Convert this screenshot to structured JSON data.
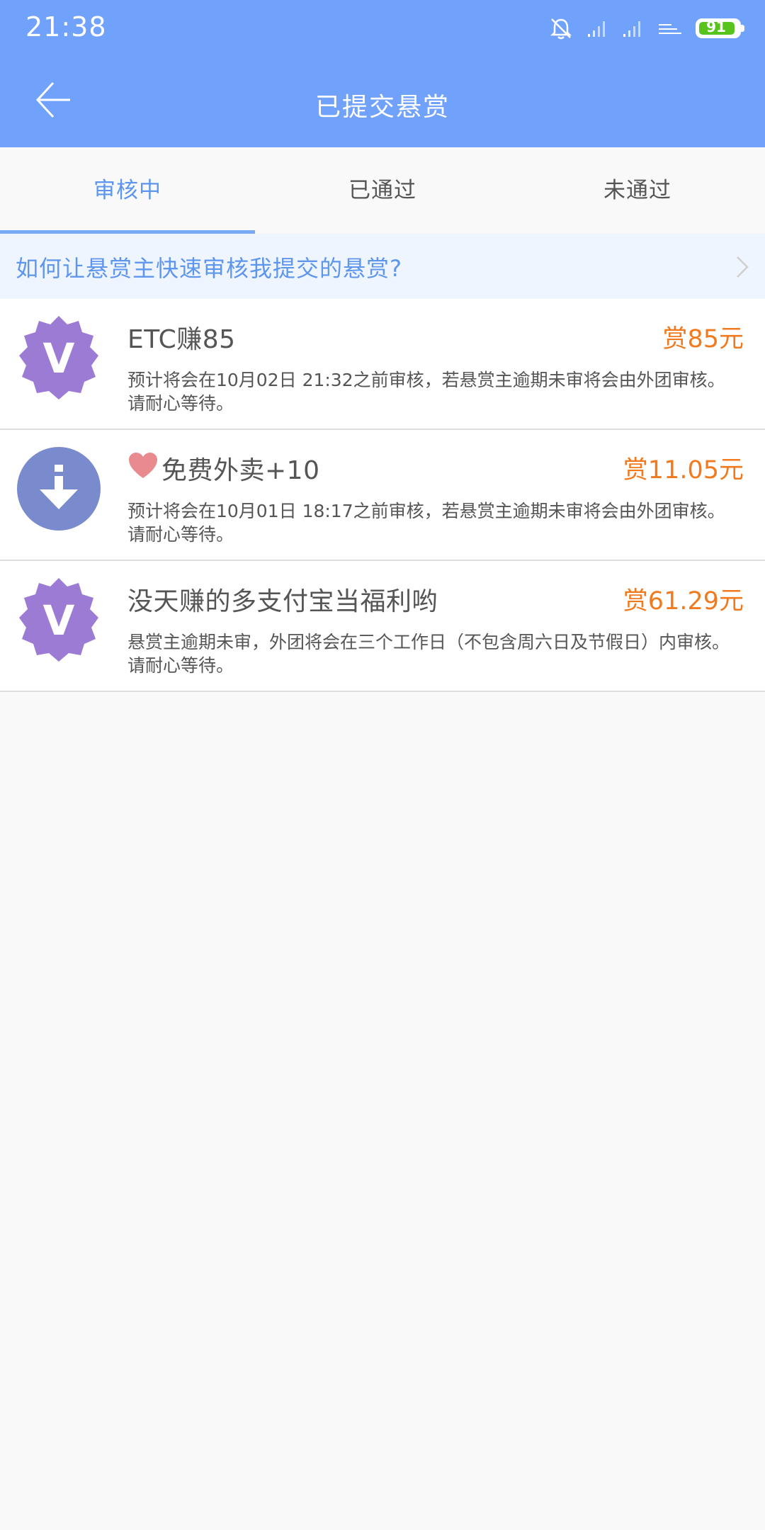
{
  "status_bar": {
    "time": "21:38",
    "battery_level": "91",
    "icons": [
      "alarm-off-icon",
      "signal-icon",
      "signal-icon",
      "network-icon",
      "battery-icon"
    ]
  },
  "app_bar": {
    "title": "已提交悬赏",
    "back_icon": "back-arrow-icon"
  },
  "tabs": [
    {
      "label": "审核中",
      "active": true
    },
    {
      "label": "已通过",
      "active": false
    },
    {
      "label": "未通过",
      "active": false
    }
  ],
  "help_banner": {
    "text": "如何让悬赏主快速审核我提交的悬赏?"
  },
  "items": [
    {
      "icon": "v-badge-icon",
      "title": "ETC赚85",
      "reward": "赏85元",
      "description": "预计将会在10月02日 21:32之前审核，若悬赏主逾期未审将会由外团审核。请耐心等待。"
    },
    {
      "icon": "download-icon",
      "title": "免费外卖+10",
      "title_prefix_icon": "heart-icon",
      "reward": "赏11.05元",
      "description": "预计将会在10月01日 18:17之前审核，若悬赏主逾期未审将会由外团审核。请耐心等待。"
    },
    {
      "icon": "v-badge-icon",
      "title": "没天赚的多支付宝当福利哟",
      "reward": "赏61.29元",
      "description": "悬赏主逾期未审，外团将会在三个工作日（不包含周六日及节假日）内审核。请耐心等待。"
    }
  ],
  "colors": {
    "header": "#70a2fb",
    "accent": "#5e96ef",
    "reward": "#f27a1e",
    "badge_purple": "#9b7bd3",
    "download_blue": "#7a8bcd"
  }
}
